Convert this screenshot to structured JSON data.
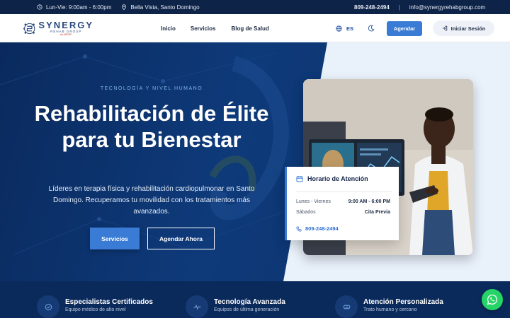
{
  "topbar": {
    "hours": "Lun-Vie: 9:00am - 6:00pm",
    "location": "Bella Vista, Santo Domingo",
    "phone": "809-248-2494",
    "separator": "|",
    "email": "info@synergyrehabgroup.com"
  },
  "header": {
    "logo": {
      "name": "SYNERGY",
      "sub": "REHAB GROUP",
      "by": "by ARDEF"
    },
    "nav": [
      "Inicio",
      "Servicios",
      "Blog de Salud"
    ],
    "language": "ES",
    "agendar_label": "Agendar",
    "login_label": "Iniciar Sesión"
  },
  "hero": {
    "eyebrow": "TECNOLOGÍA Y NIVEL HUMANO",
    "title": "Rehabilitación de Élite para tu Bienestar",
    "description": "Líderes en terapia física y rehabilitación cardiopulmonar en Santo Domingo. Recuperamos tu movilidad con los tratamientos más avanzados.",
    "primary_button": "Servicios",
    "secondary_button": "Agendar Ahora"
  },
  "schedule": {
    "title": "Horario de Atención",
    "rows": [
      {
        "day": "Lunes - Viernes",
        "time": "9:00 AM - 6:00 PM"
      },
      {
        "day": "Sábados",
        "time": "Cita Previa"
      }
    ],
    "phone": "809-248-2494"
  },
  "features": [
    {
      "title": "Especialistas Certificados",
      "subtitle": "Equipo médico de alto nivel",
      "icon": "shield-check-icon"
    },
    {
      "title": "Tecnología Avanzada",
      "subtitle": "Equipos de última generación",
      "icon": "heartbeat-icon"
    },
    {
      "title": "Atención Personalizada",
      "subtitle": "Trato humano y cercano",
      "icon": "handshake-icon"
    }
  ],
  "colors": {
    "primary": "#3a7bd5",
    "navy": "#0b2a5c",
    "topbar": "#0d2347",
    "whatsapp": "#25d366"
  }
}
